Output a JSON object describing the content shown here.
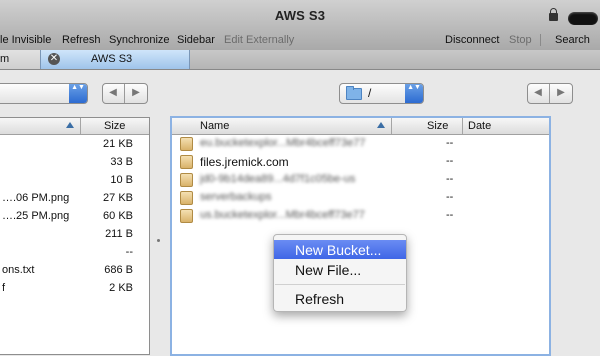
{
  "window": {
    "title": "AWS S3"
  },
  "toolbar": {
    "items": [
      "le Invisible",
      "Refresh",
      "Synchronize",
      "Sidebar",
      "Edit Externally"
    ],
    "disconnect": "Disconnect",
    "stop": "Stop",
    "search": "Search"
  },
  "tabs": {
    "left_partial": "m",
    "active": "AWS S3",
    "close_glyph": "✕"
  },
  "path": {
    "right_current": "/",
    "nav_back": "◀",
    "nav_forward": "▶",
    "popup_arrows": "▲▼"
  },
  "left_pane": {
    "header_size": "Size",
    "rows": [
      {
        "name": "",
        "size": "21 KB"
      },
      {
        "name": "",
        "size": "33 B"
      },
      {
        "name": "",
        "size": "10 B"
      },
      {
        "name": "….06 PM.png",
        "size": "27 KB"
      },
      {
        "name": "….25 PM.png",
        "size": "60 KB"
      },
      {
        "name": "",
        "size": "211 B"
      },
      {
        "name": "",
        "size": "--"
      },
      {
        "name": "ons.txt",
        "size": "686 B"
      },
      {
        "name": "f",
        "size": "2 KB"
      }
    ]
  },
  "right_pane": {
    "headers": {
      "name": "Name",
      "size": "Size",
      "date": "Date"
    },
    "rows": [
      {
        "name": "eu.bucketexplor...Mbr4bceff73e77",
        "size": "--",
        "blurred": true
      },
      {
        "name": "files.jremick.com",
        "size": "--",
        "blurred": false
      },
      {
        "name": "jd0-9b14dea89...4d7f1c05be-us",
        "size": "--",
        "blurred": true
      },
      {
        "name": "serverbackups",
        "size": "--",
        "blurred": true
      },
      {
        "name": "us.bucketexplor...Mbr4bceff73e77",
        "size": "--",
        "blurred": true
      }
    ]
  },
  "context_menu": {
    "items": [
      "New Bucket...",
      "New File...",
      "Refresh"
    ],
    "highlighted_index": 0
  },
  "colors": {
    "highlight": "#3f66e6",
    "selection_border": "#8cb2e3",
    "popup_accent": "#2c6bd1"
  }
}
